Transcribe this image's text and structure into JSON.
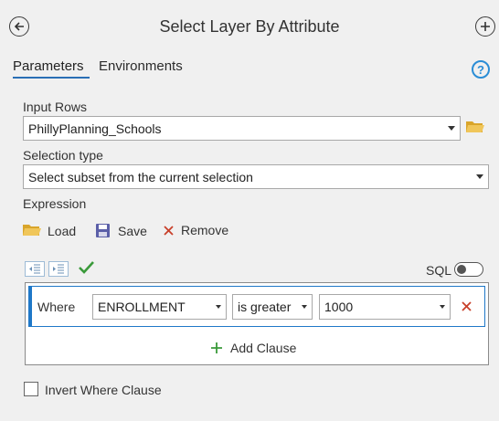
{
  "header": {
    "title": "Select Layer By Attribute"
  },
  "tabs": [
    {
      "label": "Parameters",
      "active": true
    },
    {
      "label": "Environments",
      "active": false
    }
  ],
  "help": {
    "glyph": "?"
  },
  "input_rows": {
    "label": "Input Rows",
    "value": "PhillyPlanning_Schools"
  },
  "selection_type": {
    "label": "Selection type",
    "value": "Select subset from the current selection"
  },
  "expression": {
    "label": "Expression",
    "load_label": "Load",
    "save_label": "Save",
    "remove_label": "Remove",
    "sql_label": "SQL",
    "sql_enabled": false
  },
  "clause": {
    "where_label": "Where",
    "field": "ENROLLMENT",
    "operator": "is greater",
    "value": "1000",
    "add_clause_label": "Add Clause"
  },
  "invert": {
    "label": "Invert Where Clause",
    "checked": false
  },
  "colors": {
    "accent": "#1f78c8",
    "folder": "#e8b53a",
    "remove": "#c8402a",
    "check": "#3a9a3a",
    "add": "#3a9a3a"
  }
}
